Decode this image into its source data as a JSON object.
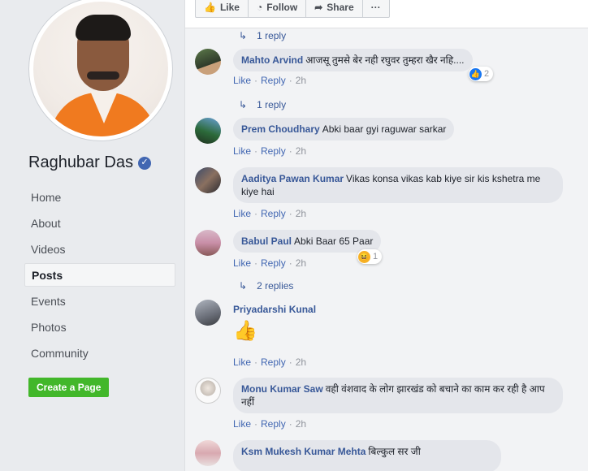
{
  "page": {
    "name": "Raghubar Das",
    "verified_icon": "verified-check-icon"
  },
  "nav": {
    "items": [
      {
        "label": "Home"
      },
      {
        "label": "About"
      },
      {
        "label": "Videos"
      },
      {
        "label": "Posts",
        "active": true
      },
      {
        "label": "Events"
      },
      {
        "label": "Photos"
      },
      {
        "label": "Community"
      }
    ],
    "create_page": "Create a Page"
  },
  "actions": {
    "like": "Like",
    "follow": "Follow",
    "share": "Share",
    "more": "···"
  },
  "comment_actions": {
    "like": "Like",
    "reply": "Reply"
  },
  "threads": {
    "top_replies": "1 reply",
    "c1": {
      "author": "Mahto Arvind",
      "text": "आजसू तुमसे बेर नही रघुवर तुम्हरा खैर नहि....",
      "time": "2h",
      "reaction_count": "2",
      "replies": "1 reply"
    },
    "c2": {
      "author": "Prem Choudhary",
      "text": "Abki baar gyi raguwar sarkar",
      "time": "2h"
    },
    "c3": {
      "author": "Aaditya Pawan Kumar",
      "text": "Vikas konsa vikas kab kiye sir kis kshetra me kiye hai",
      "time": "2h"
    },
    "c4": {
      "author": "Babul Paul",
      "text": "Abki Baar 65 Paar",
      "time": "2h",
      "reaction_count": "1",
      "replies": "2 replies"
    },
    "c5": {
      "author": "Priyadarshi Kunal",
      "text": "👍",
      "time": "2h"
    },
    "c6": {
      "author": "Monu Kumar Saw",
      "text": "वही वंशवाद के लोग झारखंड को बचाने का काम कर रही है आप नहीं",
      "time": "2h"
    },
    "c7": {
      "author": "Ksm Mukesh Kumar Mehta",
      "text": "बिल्कुल सर जी"
    }
  },
  "colors": {
    "link": "#385898",
    "like_blue": "#4267b2",
    "create_green": "#42b72a",
    "bubble_bg": "#e4e6eb"
  }
}
